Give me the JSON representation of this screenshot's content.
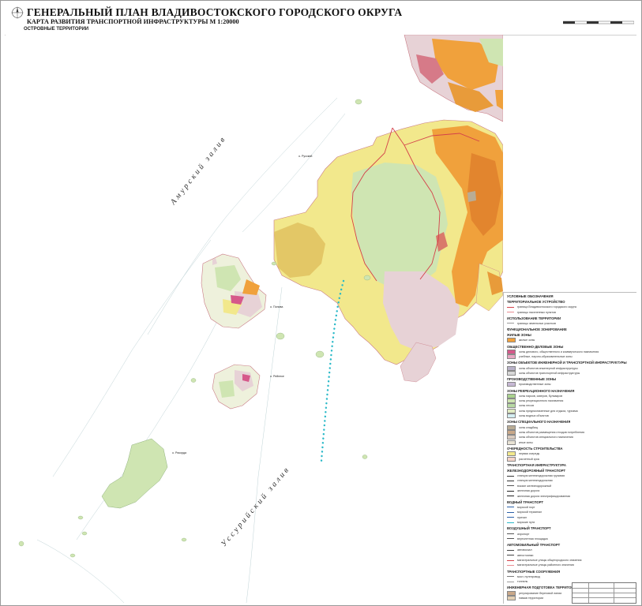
{
  "header": {
    "title": "ГЕНЕРАЛЬНЫЙ ПЛАН ВЛАДИВОСТОКСКОГО ГОРОДСКОГО ОКРУГА",
    "subtitle": "КАРТА РАЗВИТИЯ ТРАНСПОРТНОЙ ИНФРАСТРУКТУРЫ М 1:20000",
    "section": "ОСТРОВНЫЕ ТЕРРИТОРИИ"
  },
  "map": {
    "water_labels": {
      "amur": "Амурский залив",
      "ussuri": "Уссурийский залив"
    },
    "islands": [
      {
        "key": "russky",
        "label": "о. Русский"
      },
      {
        "key": "popova",
        "label": "о. Попова"
      },
      {
        "key": "reineke",
        "label": "о. Рейнеке"
      },
      {
        "key": "rikorda",
        "label": "о. Рикорда"
      }
    ],
    "colors": {
      "water": "#ffffff",
      "land_yellow": "#f2e88c",
      "land_orange": "#f0a13c",
      "land_green": "#cfe5b2",
      "land_pink": "#e7d2d6",
      "land_light": "#eef1dc",
      "road_red": "#d4414a",
      "ferry_cyan": "#2ab9c8"
    }
  },
  "legend": {
    "heading": "УСЛОВНЫЕ ОБОЗНАЧЕНИЯ",
    "sections": [
      {
        "title": "ТЕРРИТОРИАЛЬНОЕ УСТРОЙСТВО",
        "items": [
          {
            "label": "граница Владивостокского городского округа",
            "color": "#d4414a",
            "kind": "line"
          },
          {
            "label": "границы населенных пунктов",
            "color": "#e88c92",
            "kind": "line"
          }
        ]
      },
      {
        "title": "ИСПОЛЬЗОВАНИЕ ТЕРРИТОРИИ",
        "items": [
          {
            "label": "границы земельных участков",
            "color": "#9a9a9a",
            "kind": "line"
          }
        ]
      },
      {
        "title": "ФУНКЦИОНАЛЬНОЕ ЗОНИРОВАНИЕ",
        "items": []
      },
      {
        "title": "ЖИЛЫЕ ЗОНЫ",
        "items": [
          {
            "label": "жилые зоны",
            "color": "#f0a13c",
            "kind": "box"
          }
        ]
      },
      {
        "title": "ОБЩЕСТВЕННО-ДЕЛОВЫЕ ЗОНЫ",
        "items": [
          {
            "label": "зоны делового, общественного и коммерческого назначения",
            "color": "#d6588a",
            "kind": "box"
          },
          {
            "label": "учебные, научно-образовательные зоны",
            "color": "#e8a6c2",
            "kind": "box"
          }
        ]
      },
      {
        "title": "ЗОНЫ ОБЪЕКТОВ ИНЖЕНЕРНОЙ И ТРАНСПОРТНОЙ ИНФРАСТРУКТУРЫ",
        "items": [
          {
            "label": "зоны объектов инженерной инфраструктуры",
            "color": "#b9b2c8",
            "kind": "box"
          },
          {
            "label": "зоны объектов транспортной инфраструктуры",
            "color": "#d8d8d8",
            "kind": "box"
          }
        ]
      },
      {
        "title": "ПРОИЗВОДСТВЕННЫЕ ЗОНЫ",
        "items": [
          {
            "label": "производственные зоны",
            "color": "#c6b8d4",
            "kind": "box"
          }
        ]
      },
      {
        "title": "ЗОНЫ РЕКРЕАЦИОННОГО НАЗНАЧЕНИЯ",
        "items": [
          {
            "label": "зоны парков, скверов, бульваров",
            "color": "#a9d28d",
            "kind": "box"
          },
          {
            "label": "зоны рекреационного назначения",
            "color": "#cfe5b2",
            "kind": "box"
          },
          {
            "label": "зоны лесов",
            "color": "#b7d9a3",
            "kind": "box"
          },
          {
            "label": "зоны предназначенные для отдыха, туризма",
            "color": "#e1ecc4",
            "kind": "box"
          },
          {
            "label": "зоны водных объектов",
            "color": "#d4eef2",
            "kind": "box"
          }
        ]
      },
      {
        "title": "ЗОНЫ СПЕЦИАЛЬНОГО НАЗНАЧЕНИЯ",
        "items": [
          {
            "label": "зоны кладбищ",
            "color": "#b9ac95",
            "kind": "box"
          },
          {
            "label": "зоны объектов размещения отходов потребления",
            "color": "#c9a889",
            "kind": "box"
          },
          {
            "label": "зоны объектов специального назначения",
            "color": "#d9cbbf",
            "kind": "box"
          },
          {
            "label": "иные зоны",
            "color": "#e8e2d4",
            "kind": "box"
          }
        ]
      },
      {
        "title": "ОЧЕРЕДНОСТЬ СТРОИТЕЛЬСТВА",
        "items": [
          {
            "label": "первая очередь",
            "color": "#f2e88c",
            "kind": "box"
          },
          {
            "label": "расчетный срок",
            "color": "#f6d5c9",
            "kind": "box"
          }
        ]
      },
      {
        "title": "ТРАНСПОРТНАЯ ИНФРАСТРУКТУРА",
        "items": []
      },
      {
        "title": "ЖЕЛЕЗНОДОРОЖНЫЙ ТРАНСПОРТ",
        "items": [
          {
            "label": "станция железнодорожная грузовая",
            "color": "#333333",
            "kind": "line"
          },
          {
            "label": "станция железнодорожная",
            "color": "#333333",
            "kind": "line"
          },
          {
            "label": "вокзал железнодорожный",
            "color": "#555555",
            "kind": "line"
          },
          {
            "label": "железная дорога",
            "color": "#222222",
            "kind": "line"
          },
          {
            "label": "железная дорога электрифицированная",
            "color": "#222222",
            "kind": "line"
          }
        ]
      },
      {
        "title": "ВОДНЫЙ ТРАНСПОРТ",
        "items": [
          {
            "label": "морской порт",
            "color": "#2a5fa8",
            "kind": "line"
          },
          {
            "label": "морской терминал",
            "color": "#2a5fa8",
            "kind": "line"
          },
          {
            "label": "причал",
            "color": "#2a5fa8",
            "kind": "line"
          },
          {
            "label": "морские пути",
            "color": "#2ab9c8",
            "kind": "line"
          }
        ]
      },
      {
        "title": "ВОЗДУШНЫЙ ТРАНСПОРТ",
        "items": [
          {
            "label": "аэропорт",
            "color": "#555555",
            "kind": "line"
          },
          {
            "label": "вертолетная площадка",
            "color": "#555555",
            "kind": "line"
          }
        ]
      },
      {
        "title": "АВТОМОБИЛЬНЫЙ ТРАНСПОРТ",
        "items": [
          {
            "label": "автовокзал",
            "color": "#444444",
            "kind": "line"
          },
          {
            "label": "автостоянки",
            "color": "#444444",
            "kind": "line"
          },
          {
            "label": "магистральные улицы общегородского значения",
            "color": "#d4414a",
            "kind": "line"
          },
          {
            "label": "магистральные улицы районного значения",
            "color": "#e88c92",
            "kind": "line"
          }
        ]
      },
      {
        "title": "ТРАНСПОРТНЫЕ СООРУЖЕНИЯ",
        "items": [
          {
            "label": "мост, путепровод",
            "color": "#7a7a7a",
            "kind": "line"
          },
          {
            "label": "тоннель",
            "color": "#9a9a9a",
            "kind": "line"
          }
        ]
      },
      {
        "title": "ИНЖЕНЕРНАЯ ПОДГОТОВКА ТЕРРИТОРИИ",
        "items": [
          {
            "label": "регулирование береговой линии",
            "color": "#c9a889",
            "kind": "box"
          },
          {
            "label": "намыв территории",
            "color": "#e2cfb3",
            "kind": "box"
          }
        ]
      }
    ]
  }
}
